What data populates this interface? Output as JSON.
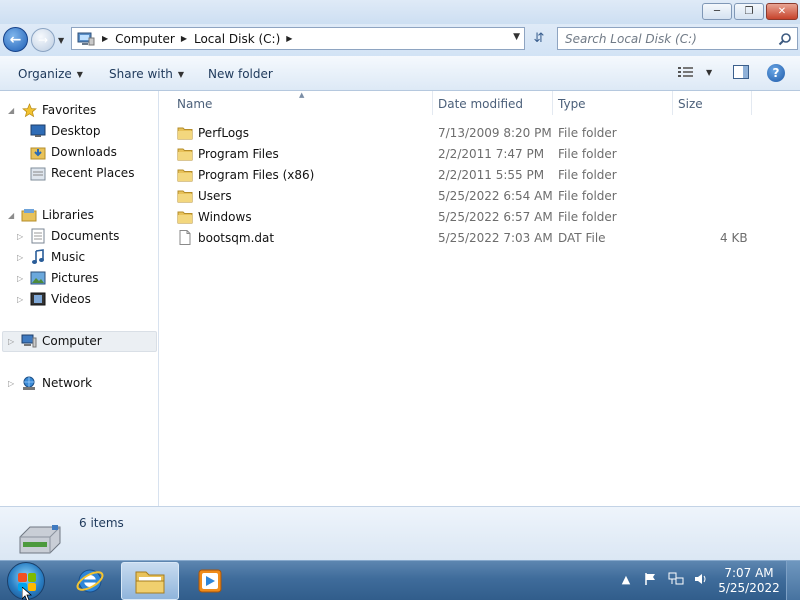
{
  "window": {
    "minimize_icon": "minimize-icon",
    "maximize_icon": "restore-icon",
    "close_icon": "close-icon"
  },
  "address": {
    "location_icon": "computer-location-icon",
    "crumbs": [
      "Computer",
      "Local Disk (C:)"
    ],
    "search_placeholder": "Search Local Disk (C:)"
  },
  "toolbar": {
    "organize": "Organize",
    "share_with": "Share with",
    "new_folder": "New folder",
    "help": "?"
  },
  "nav": {
    "favorites": "Favorites",
    "desktop": "Desktop",
    "downloads": "Downloads",
    "recent_places": "Recent Places",
    "libraries": "Libraries",
    "documents": "Documents",
    "music": "Music",
    "pictures": "Pictures",
    "videos": "Videos",
    "computer": "Computer",
    "network": "Network"
  },
  "columns": {
    "name": "Name",
    "date_modified": "Date modified",
    "type": "Type",
    "size": "Size"
  },
  "files": [
    {
      "name": "PerfLogs",
      "date": "7/13/2009 8:20 PM",
      "type": "File folder",
      "size": "",
      "icon": "folder-icon"
    },
    {
      "name": "Program Files",
      "date": "2/2/2011 7:47 PM",
      "type": "File folder",
      "size": "",
      "icon": "folder-icon"
    },
    {
      "name": "Program Files (x86)",
      "date": "2/2/2011 5:55 PM",
      "type": "File folder",
      "size": "",
      "icon": "folder-icon"
    },
    {
      "name": "Users",
      "date": "5/25/2022 6:54 AM",
      "type": "File folder",
      "size": "",
      "icon": "folder-icon"
    },
    {
      "name": "Windows",
      "date": "5/25/2022 6:57 AM",
      "type": "File folder",
      "size": "",
      "icon": "folder-icon"
    },
    {
      "name": "bootsqm.dat",
      "date": "5/25/2022 7:03 AM",
      "type": "DAT File",
      "size": "4 KB",
      "icon": "file-icon"
    }
  ],
  "details": {
    "item_count": "6 items"
  },
  "taskbar": {
    "time": "7:07 AM",
    "date": "5/25/2022"
  },
  "colors": {
    "accent": "#1e395b",
    "folder": "#e8c25a",
    "taskbar": "#3f6c9b"
  }
}
